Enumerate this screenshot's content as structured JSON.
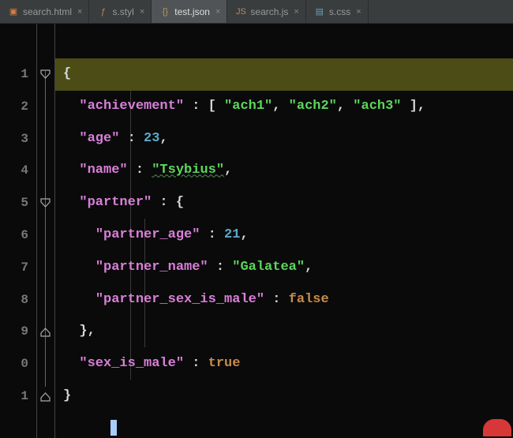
{
  "tabs": [
    {
      "icon": "▣",
      "iconClass": "ic-html",
      "label": "search.html"
    },
    {
      "icon": "ƒ",
      "iconClass": "ic-styl",
      "label": "s.styl"
    },
    {
      "icon": "{}",
      "iconClass": "ic-json",
      "label": "test.json",
      "active": true
    },
    {
      "icon": "JS",
      "iconClass": "ic-js",
      "label": "search.js"
    },
    {
      "icon": "▤",
      "iconClass": "ic-css",
      "label": "s.css"
    }
  ],
  "close_glyph": "×",
  "line_numbers": [
    "1",
    "2",
    "3",
    "4",
    "5",
    "6",
    "7",
    "8",
    "9",
    "0",
    "1"
  ],
  "code": {
    "l1": {
      "brace": "{"
    },
    "l2": {
      "key": "\"achievement\"",
      "colon": " : ",
      "lb": "[ ",
      "a1": "\"ach1\"",
      "c": ", ",
      "a2": "\"ach2\"",
      "a3": "\"ach3\"",
      "rb": " ]",
      "comma": ","
    },
    "l3": {
      "key": "\"age\"",
      "colon": " : ",
      "val": "23",
      "comma": ","
    },
    "l4": {
      "key": "\"name\"",
      "colon": " : ",
      "val": "\"Tsybius\"",
      "comma": ","
    },
    "l5": {
      "key": "\"partner\"",
      "colon": " : ",
      "brace": "{"
    },
    "l6": {
      "key": "\"partner_age\"",
      "colon": " : ",
      "val": "21",
      "comma": ","
    },
    "l7": {
      "key": "\"partner_name\"",
      "colon": " : ",
      "val": "\"Galatea\"",
      "comma": ","
    },
    "l8": {
      "key": "\"partner_sex_is_male\"",
      "colon": " : ",
      "val": "false"
    },
    "l9": {
      "brace": "}",
      "comma": ","
    },
    "l10": {
      "key": "\"sex_is_male\"",
      "colon": " : ",
      "val": "true"
    },
    "l11": {
      "brace": "}"
    }
  }
}
